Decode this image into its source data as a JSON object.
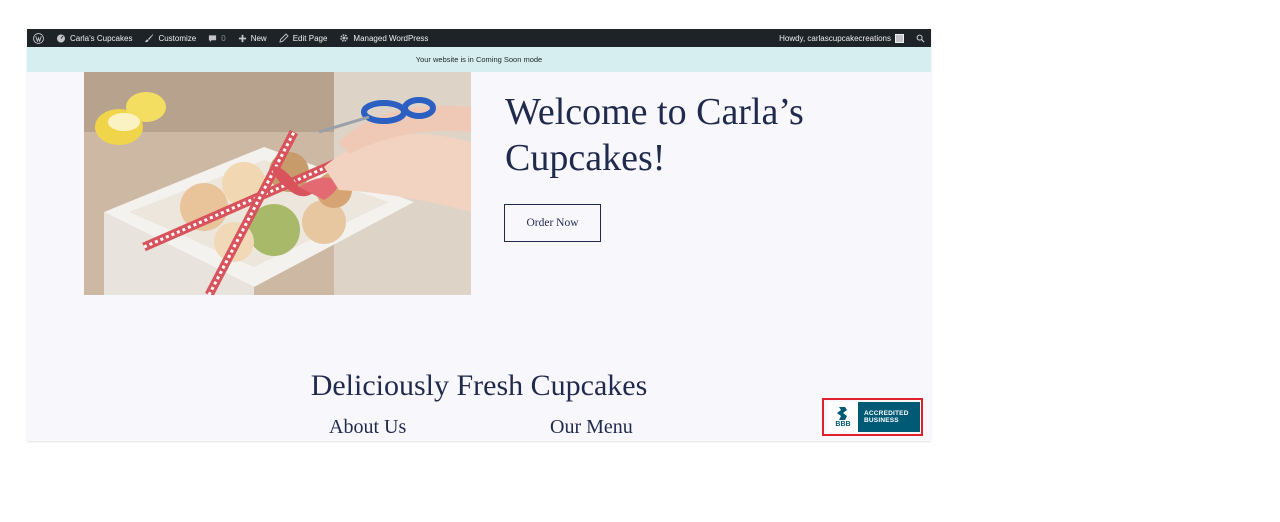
{
  "admin_bar": {
    "site_name": "Carla's Cupcakes",
    "customize": "Customize",
    "comments_count": "0",
    "new": "New",
    "edit_page": "Edit Page",
    "managed": "Managed WordPress",
    "howdy": "Howdy, carlascupcakecreations"
  },
  "notice": "Your website is in Coming Soon mode",
  "hero": {
    "title": "Welcome to Carla’s Cupcakes!",
    "button": "Order Now"
  },
  "section": {
    "heading": "Deliciously Fresh Cupcakes",
    "nav": [
      "About Us",
      "Our Menu"
    ]
  },
  "badge": {
    "logo": "BBB",
    "line1": "ACCREDITED",
    "line2": "BUSINESS"
  },
  "colors": {
    "admin_bar": "#1d2327",
    "notice_bg": "#d7eef0",
    "page_bg": "#f8f7fc",
    "text_navy": "#1f2a4d",
    "bbb_blue": "#015a75",
    "highlight_red": "#e0202a"
  }
}
